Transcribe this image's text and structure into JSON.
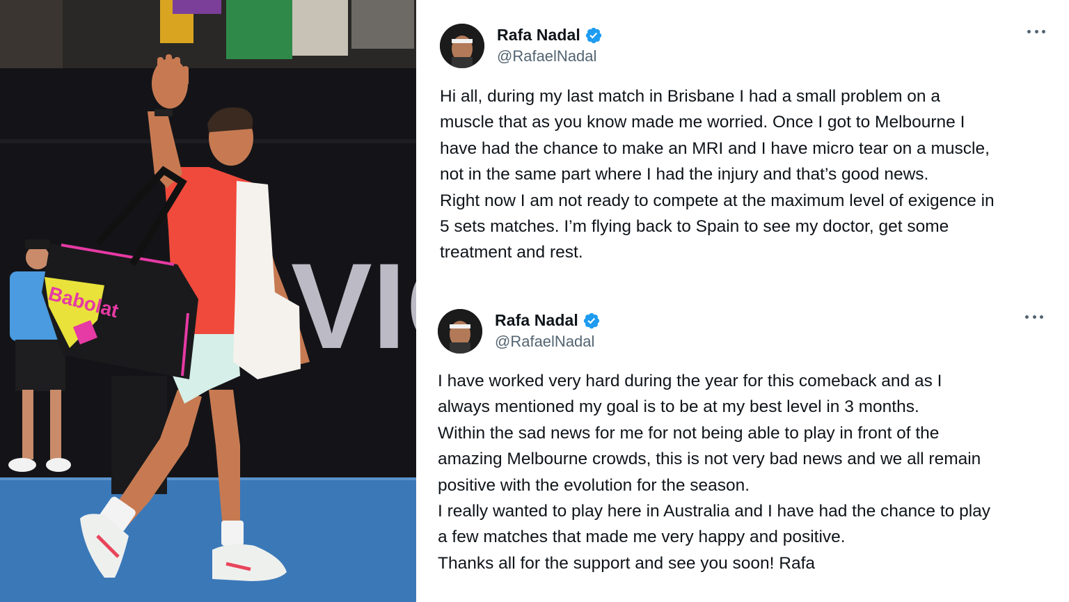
{
  "photo": {
    "scene": "tennis-player-waving",
    "colors": {
      "court": "#3b78b8",
      "backdrop": "#141418",
      "shirt": "#f04a3c",
      "shorts": "#d6efe8",
      "bag": "#1a1a1c",
      "accent_pink": "#e63aa4",
      "accent_yellow": "#e8e23a"
    },
    "backdrop_letters": "VIC"
  },
  "tweets": [
    {
      "display_name": "Rafa Nadal",
      "handle": "@RafaelNadal",
      "verified": true,
      "lines": [
        "Hi all, during my last match in Brisbane I had a small problem on a",
        "muscle that as you know made me worried. Once I got to Melbourne I",
        "have had the chance to make an MRI and I have micro tear on a muscle,",
        "not in the same part where I had the injury and that’s good news.",
        "Right now I am not ready to compete at the maximum level of exigence in",
        "5 sets matches. I’m flying back to Spain to see my doctor, get some",
        "treatment and rest."
      ]
    },
    {
      "display_name": "Rafa Nadal",
      "handle": "@RafaelNadal",
      "verified": true,
      "lines": [
        "I have worked very hard during the year for this comeback and as I",
        "always mentioned my goal is to be at my best level in 3 months.",
        "Within the sad news for me for not being able to play in front of the",
        "amazing Melbourne crowds, this is not very bad news and we all remain",
        "positive with the evolution for the season.",
        "I really wanted to play here in Australia and I have had the chance to play",
        "a few matches that made me very happy and positive.",
        "Thanks all for the support and see you soon! Rafa"
      ]
    }
  ],
  "colors": {
    "text": "#0f1419",
    "secondary": "#536471",
    "verified": "#1d9bf0"
  }
}
